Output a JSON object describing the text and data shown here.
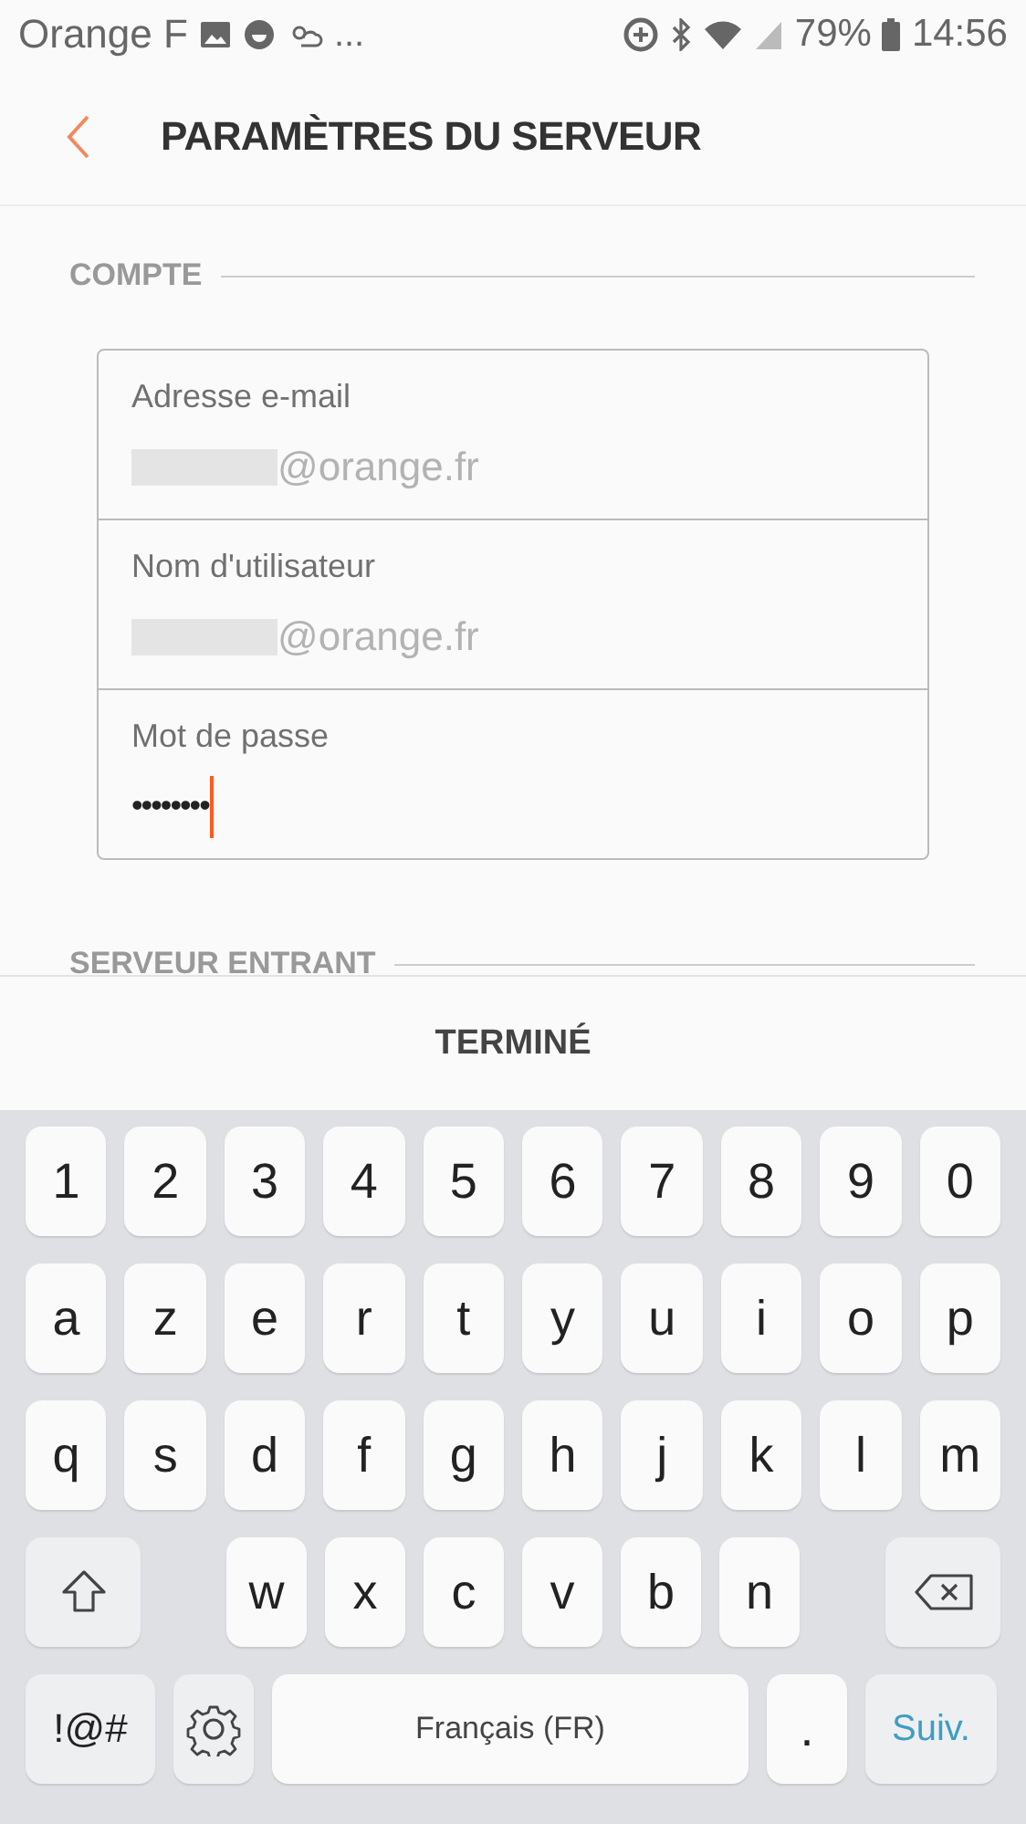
{
  "status_bar": {
    "carrier": "Orange F",
    "more": "...",
    "battery": "79%",
    "time": "14:56"
  },
  "header": {
    "title": "PARAMÈTRES DU SERVEUR"
  },
  "sections": [
    {
      "title": "COMPTE",
      "fields": [
        {
          "label": "Adresse e-mail",
          "value": "@orange.fr",
          "kind": "redacted",
          "focused": false
        },
        {
          "label": "Nom d'utilisateur",
          "value": "@orange.fr",
          "kind": "redacted",
          "focused": false
        },
        {
          "label": "Mot de passe",
          "value": "••••••••",
          "kind": "password",
          "focused": true
        }
      ]
    },
    {
      "title": "SERVEUR ENTRANT"
    }
  ],
  "done_bar": {
    "label": "TERMINÉ"
  },
  "keyboard": {
    "rows": [
      {
        "keys": [
          {
            "kind": "char",
            "label": "1"
          },
          {
            "kind": "char",
            "label": "2"
          },
          {
            "kind": "char",
            "label": "3"
          },
          {
            "kind": "char",
            "label": "4"
          },
          {
            "kind": "char",
            "label": "5"
          },
          {
            "kind": "char",
            "label": "6"
          },
          {
            "kind": "char",
            "label": "7"
          },
          {
            "kind": "char",
            "label": "8"
          },
          {
            "kind": "char",
            "label": "9"
          },
          {
            "kind": "char",
            "label": "0"
          }
        ]
      },
      {
        "keys": [
          {
            "kind": "char",
            "label": "a"
          },
          {
            "kind": "char",
            "label": "z"
          },
          {
            "kind": "char",
            "label": "e"
          },
          {
            "kind": "char",
            "label": "r"
          },
          {
            "kind": "char",
            "label": "t"
          },
          {
            "kind": "char",
            "label": "y"
          },
          {
            "kind": "char",
            "label": "u"
          },
          {
            "kind": "char",
            "label": "i"
          },
          {
            "kind": "char",
            "label": "o"
          },
          {
            "kind": "char",
            "label": "p"
          }
        ]
      },
      {
        "keys": [
          {
            "kind": "char",
            "label": "q"
          },
          {
            "kind": "char",
            "label": "s"
          },
          {
            "kind": "char",
            "label": "d"
          },
          {
            "kind": "char",
            "label": "f"
          },
          {
            "kind": "char",
            "label": "g"
          },
          {
            "kind": "char",
            "label": "h"
          },
          {
            "kind": "char",
            "label": "j"
          },
          {
            "kind": "char",
            "label": "k"
          },
          {
            "kind": "char",
            "label": "l"
          },
          {
            "kind": "char",
            "label": "m"
          }
        ]
      },
      {
        "keys": [
          {
            "kind": "shift"
          },
          {
            "kind": "char",
            "label": "w"
          },
          {
            "kind": "char",
            "label": "x"
          },
          {
            "kind": "char",
            "label": "c"
          },
          {
            "kind": "char",
            "label": "v"
          },
          {
            "kind": "char",
            "label": "b"
          },
          {
            "kind": "char",
            "label": "n"
          },
          {
            "kind": "backspace"
          }
        ]
      },
      {
        "keys": [
          {
            "kind": "symbols",
            "label": "!@#"
          },
          {
            "kind": "settings"
          },
          {
            "kind": "space",
            "label": "Français (FR)"
          },
          {
            "kind": "period",
            "label": "."
          },
          {
            "kind": "action",
            "label": "Suiv."
          }
        ]
      }
    ]
  }
}
